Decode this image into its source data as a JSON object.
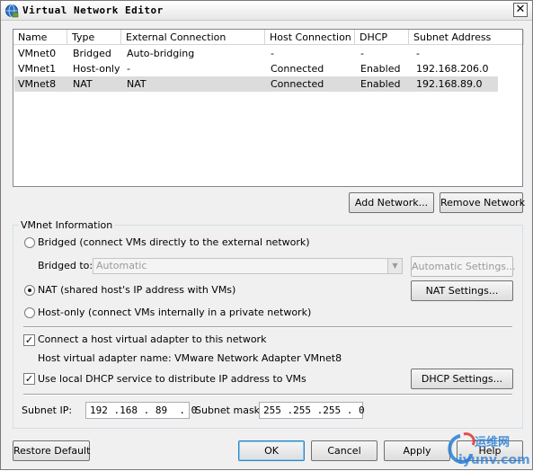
{
  "window": {
    "title": "Virtual Network Editor",
    "close_glyph": "✕"
  },
  "table": {
    "columns": [
      "Name",
      "Type",
      "External Connection",
      "Host Connection",
      "DHCP",
      "Subnet Address"
    ],
    "rows": [
      {
        "name": "VMnet0",
        "type": "Bridged",
        "external": "Auto-bridging",
        "host": "-",
        "dhcp": "-",
        "subnet": "-"
      },
      {
        "name": "VMnet1",
        "type": "Host-only",
        "external": "-",
        "host": "Connected",
        "dhcp": "Enabled",
        "subnet": "192.168.206.0"
      },
      {
        "name": "VMnet8",
        "type": "NAT",
        "external": "NAT",
        "host": "Connected",
        "dhcp": "Enabled",
        "subnet": "192.168.89.0"
      }
    ],
    "selected_row": 2
  },
  "buttons": {
    "add_network": "Add Network...",
    "remove_network": "Remove Network",
    "automatic_settings": "Automatic Settings...",
    "nat_settings": "NAT Settings...",
    "dhcp_settings": "DHCP Settings...",
    "restore_default": "Restore Default",
    "ok": "OK",
    "cancel": "Cancel",
    "apply": "Apply",
    "help": "Help"
  },
  "vmnet_info": {
    "group_label": "VMnet Information",
    "bridged_label": "Bridged (connect VMs directly to the external network)",
    "bridged_to_label": "Bridged to:",
    "bridged_to_value": "Automatic",
    "nat_label": "NAT (shared host's IP address with VMs)",
    "hostonly_label": "Host-only (connect VMs internally in a private network)",
    "selected_mode": "nat",
    "connect_adapter_label": "Connect a host virtual adapter to this network",
    "connect_adapter_checked": true,
    "adapter_name_label": "Host virtual adapter name: VMware Network Adapter VMnet8",
    "dhcp_label": "Use local DHCP service to distribute IP address to VMs",
    "dhcp_checked": true,
    "subnet_ip_label": "Subnet IP:",
    "subnet_ip_value": "192 .168 . 89  . 0",
    "subnet_mask_label": "Subnet mask:",
    "subnet_mask_value": "255 .255 .255 . 0"
  },
  "watermark": {
    "cn_text": "运维网",
    "url_text": "iyunv.com"
  },
  "icons": {
    "title_icon": "network-globe-icon",
    "dropdown": "chevron-down-icon",
    "check": "checkmark-icon"
  },
  "colors": {
    "selected_row": "#dcdcdc",
    "dialog_bg": "#f0f0f0",
    "watermark_blue": "#2a7fd4",
    "watermark_red": "#e0302a"
  }
}
